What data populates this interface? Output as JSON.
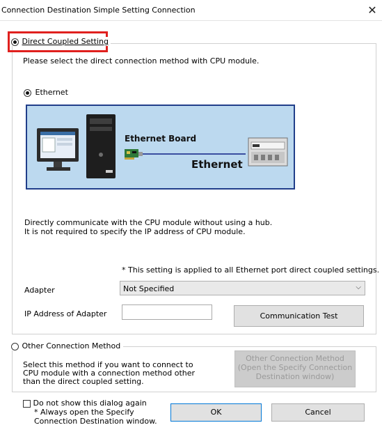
{
  "window": {
    "title": "Connection Destination Simple Setting Connection",
    "close_glyph": "✕"
  },
  "direct": {
    "radio_label": "Direct Coupled Setting",
    "selected": true,
    "description": "Please select the direct connection method with CPU module.",
    "ethernet_label": "Ethernet",
    "illustration": {
      "board_label": "Ethernet Board",
      "ethernet_label": "Ethernet"
    },
    "info_line1": "Directly communicate with the CPU module without using a hub.",
    "info_line2": "It is not required to specify the IP address of CPU module.",
    "note": "* This setting is applied to all Ethernet port direct coupled settings.",
    "adapter_label": "Adapter",
    "adapter_value": "Not Specified",
    "ip_label": "IP Address of Adapter",
    "ip_value": "",
    "comm_test_button": "Communication Test"
  },
  "other": {
    "radio_label": "Other Connection Method",
    "selected": false,
    "desc_line1": "Select this method if you want to connect to",
    "desc_line2": "CPU module with a connection method other",
    "desc_line3": "than the direct coupled setting.",
    "button_line1": "Other Connection Method",
    "button_line2": "(Open the Specify Connection",
    "button_line3": "Destination window)"
  },
  "footer": {
    "dont_show_label": "Do not show this dialog again",
    "dont_show_note1": "* Always open the Specify",
    "dont_show_note2": "Connection Destination window.",
    "ok_button": "OK",
    "cancel_button": "Cancel"
  },
  "colors": {
    "highlight": "#e0201e",
    "illustration_bg": "#bcd9ef",
    "illustration_border": "#203e8a",
    "focus_blue": "#0078d7"
  }
}
